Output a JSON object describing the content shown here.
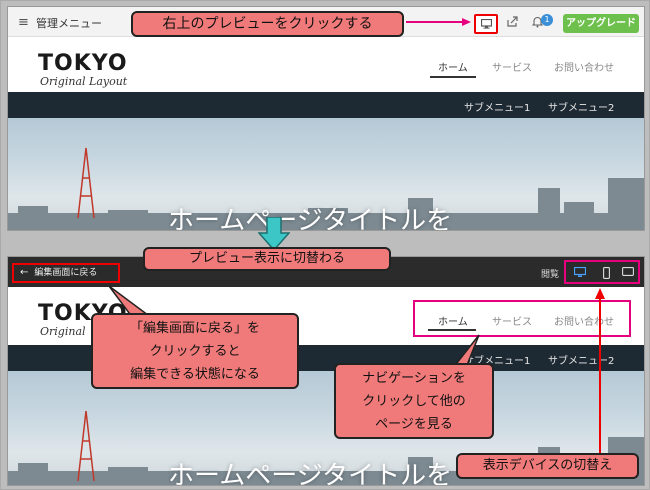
{
  "top": {
    "admin_title": "管理メニュー",
    "upgrade_label": "アップグレード",
    "notification_count": "1",
    "logo_main": "TOKYO",
    "logo_sub": "Original Layout",
    "nav": [
      "ホーム",
      "サービス",
      "お問い合わせ"
    ],
    "subnav": [
      "サブメニュー1",
      "サブメニュー2"
    ],
    "hero_title": "ホームページタイトルを"
  },
  "bottom": {
    "back_label": "編集画面に戻る",
    "publish_label": "閲覧",
    "logo_main": "TOKYO",
    "logo_sub": "Original",
    "nav": [
      "ホーム",
      "サービス",
      "お問い合わせ"
    ],
    "subnav": [
      "サブメニュー1",
      "サブメニュー2"
    ],
    "hero_title": "ホームページタイトルを"
  },
  "callouts": {
    "click_preview": "右上のプレビューをクリックする",
    "switch_preview": "プレビュー表示に切替わる",
    "back_edit": [
      "「編集画面に戻る」を",
      "クリックすると",
      "編集できる状態になる"
    ],
    "nav_click": [
      "ナビゲーションを",
      "クリックして他の",
      "ページを見る"
    ],
    "device_switch": "表示デバイスの切替え"
  },
  "colors": {
    "callout_fill": "#f07a7a",
    "highlight_red": "#ee0000",
    "highlight_pink": "#e6007e",
    "upgrade_green": "#6dc04b",
    "subnav_dark": "#1e2a33",
    "big_arrow": "#3cc6c6"
  },
  "icons": [
    "hamburger-icon",
    "desktop-icon",
    "share-icon",
    "bell-icon",
    "back-arrow-icon",
    "tablet-icon",
    "mobile-icon"
  ]
}
